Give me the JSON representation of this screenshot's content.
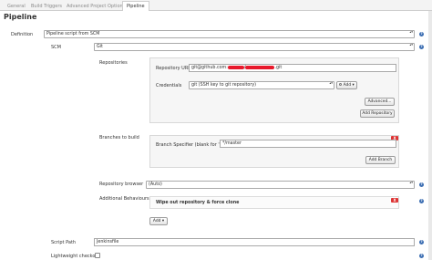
{
  "tabs": [
    {
      "label": "General"
    },
    {
      "label": "Build Triggers"
    },
    {
      "label": "Advanced Project Options"
    },
    {
      "label": "Pipeline"
    }
  ],
  "section_title": "Pipeline",
  "definition": {
    "label": "Definition",
    "value": "Pipeline script from SCM"
  },
  "scm": {
    "label": "SCM",
    "value": "Git"
  },
  "repositories": {
    "label": "Repositories",
    "url_label": "Repository URL",
    "url_prefix": "git@github.com:",
    "url_suffix": ".git",
    "credentials_label": "Credentials",
    "credentials_value": "git (SSH key to git repository)",
    "add_button": "Add",
    "advanced_button": "Advanced...",
    "add_repository_button": "Add Repository"
  },
  "branches": {
    "label": "Branches to build",
    "specifier_label": "Branch Specifier (blank for 'any')",
    "specifier_value": "*/master",
    "add_branch_button": "Add Branch",
    "delete_glyph": "X"
  },
  "repo_browser": {
    "label": "Repository browser",
    "value": "(Auto)"
  },
  "additional_behaviours": {
    "label": "Additional Behaviours",
    "item": "Wipe out repository & force clone",
    "add_button": "Add",
    "delete_glyph": "X"
  },
  "script_path": {
    "label": "Script Path",
    "value": "Jenkinsfile"
  },
  "lightweight_checkout": {
    "label": "Lightweight checkout",
    "checked": false
  },
  "icons": {
    "help": "?",
    "dropdown": "▾",
    "select_arrows": "▴▾"
  },
  "colors": {
    "redaction": "#e8192c",
    "delete": "#dd3333",
    "help": "#3e6fb3"
  }
}
